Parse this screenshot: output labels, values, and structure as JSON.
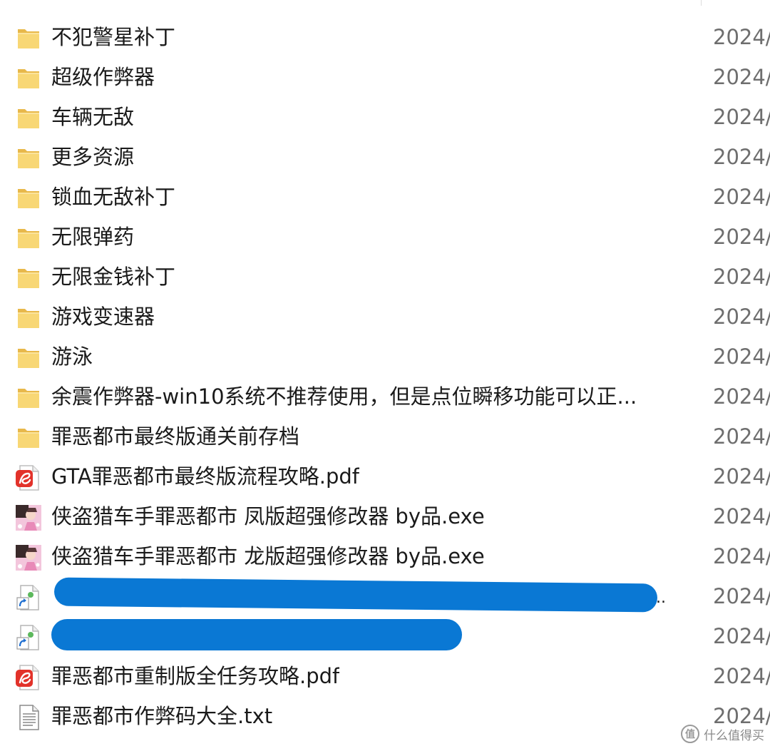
{
  "files": [
    {
      "name": "不犯警星补丁",
      "icon": "folder-icon",
      "date": "2024/"
    },
    {
      "name": "超级作弊器",
      "icon": "folder-icon",
      "date": "2024/"
    },
    {
      "name": "车辆无敌",
      "icon": "folder-icon",
      "date": "2024/"
    },
    {
      "name": "更多资源",
      "icon": "folder-icon",
      "date": "2024/"
    },
    {
      "name": "锁血无敌补丁",
      "icon": "folder-icon",
      "date": "2024/"
    },
    {
      "name": "无限弹药",
      "icon": "folder-icon",
      "date": "2024/"
    },
    {
      "name": "无限金钱补丁",
      "icon": "folder-icon",
      "date": "2024/"
    },
    {
      "name": "游戏变速器",
      "icon": "folder-icon",
      "date": "2024/"
    },
    {
      "name": "游泳",
      "icon": "folder-icon",
      "date": "2024/"
    },
    {
      "name": "余震作弊器-win10系统不推荐使用，但是点位瞬移功能可以正...",
      "icon": "folder-icon",
      "date": "2024/"
    },
    {
      "name": "罪恶都市最终版通关前存档",
      "icon": "folder-icon",
      "date": "2024/"
    },
    {
      "name": "GTA罪恶都市最终版流程攻略.pdf",
      "icon": "pdf-icon",
      "date": "2024/"
    },
    {
      "name": "侠盗猎车手罪恶都市 凤版超强修改器 by品.exe",
      "icon": "exe-icon",
      "date": "2024/"
    },
    {
      "name": "侠盗猎车手罪恶都市 龙版超强修改器 by品.exe",
      "icon": "exe-icon",
      "date": "2024/"
    },
    {
      "name": "",
      "icon": "shortcut-icon",
      "date": "2024/"
    },
    {
      "name": "",
      "icon": "shortcut-icon",
      "date": "2024/"
    },
    {
      "name": "罪恶都市重制版全任务攻略.pdf",
      "icon": "pdf-icon",
      "date": "2024/"
    },
    {
      "name": "罪恶都市作弊码大全.txt",
      "icon": "txt-icon",
      "date": "2024/"
    }
  ],
  "watermark": {
    "text": "什么值得买",
    "icon": "zhi-icon",
    "glyph": "值"
  },
  "colors": {
    "folder": "#f8d775",
    "pdf": "#e2322a",
    "redaction": "#0a78d4"
  }
}
